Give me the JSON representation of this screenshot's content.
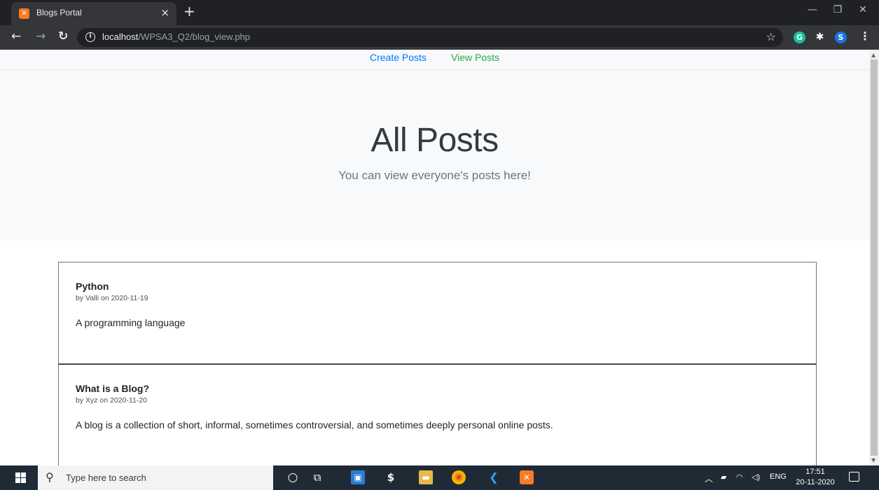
{
  "browser": {
    "tab_title": "Blogs Portal",
    "tab_close": "×",
    "new_tab": "+",
    "url_host": "localhost",
    "url_path": "/WPSA3_Q2/blog_view.php",
    "profile_initial": "S",
    "grammarly_initial": "G"
  },
  "navbar": {
    "create_label": "Create Posts",
    "view_label": "View Posts"
  },
  "jumbotron": {
    "title": "All Posts",
    "subtitle": "You can view everyone's posts here!"
  },
  "posts": [
    {
      "title": "Python",
      "meta": "by Valli on 2020-11-19",
      "body": "A programming language"
    },
    {
      "title": "What is a Blog?",
      "meta": "by Xyz on 2020-11-20",
      "body": "A blog is a collection of short, informal, sometimes controversial, and sometimes deeply personal online posts."
    }
  ],
  "taskbar": {
    "search_placeholder": "Type here to search",
    "language": "ENG",
    "time": "17:51",
    "date": "20-11-2020"
  },
  "colors": {
    "link_primary": "#007bff",
    "link_success": "#28a745",
    "chrome_dark": "#202124"
  }
}
